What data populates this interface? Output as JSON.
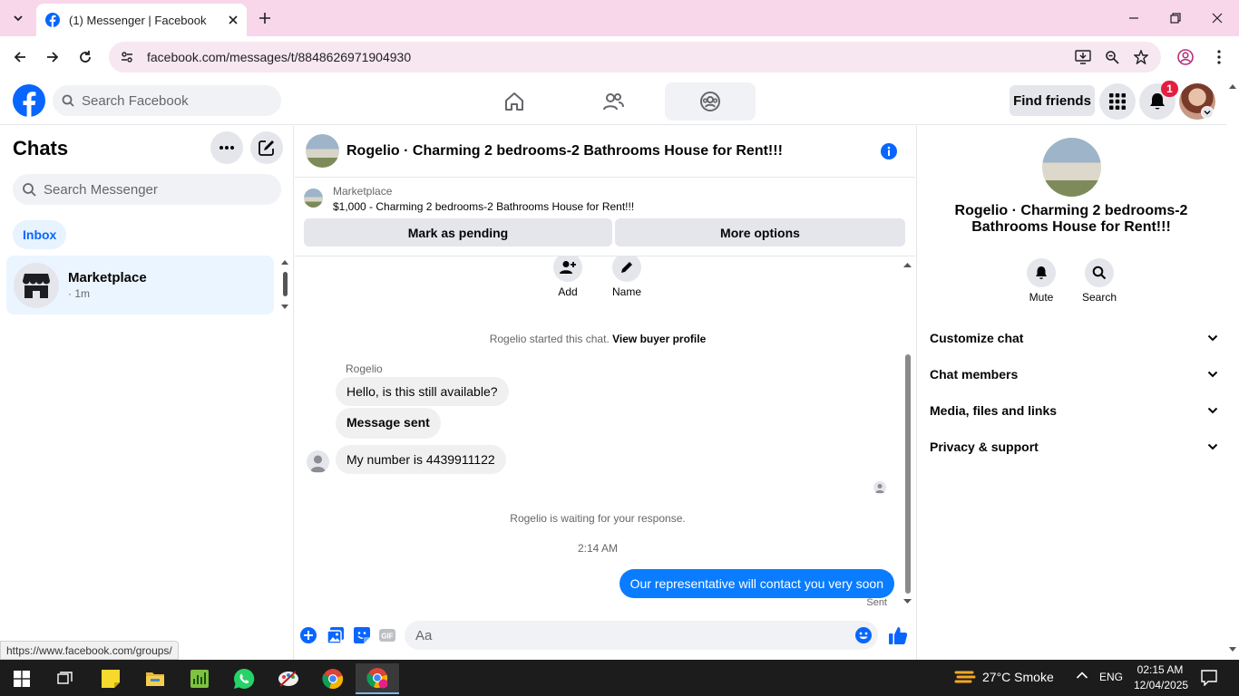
{
  "browser": {
    "tab_title": "(1) Messenger | Facebook",
    "url": "facebook.com/messages/t/8848626971904930",
    "status_url": "https://www.facebook.com/groups/"
  },
  "header": {
    "search_placeholder": "Search Facebook",
    "find_friends": "Find friends",
    "notification_count": "1"
  },
  "sidebar": {
    "title": "Chats",
    "search_placeholder": "Search Messenger",
    "filter_inbox": "Inbox",
    "chats": [
      {
        "name": "Marketplace",
        "time": "· 1m"
      }
    ]
  },
  "conversation": {
    "title": "Rogelio · Charming 2 bedrooms-2 Bathrooms House for Rent!!!",
    "listing_label": "Marketplace",
    "listing_desc": "$1,000 - Charming 2 bedrooms-2 Bathrooms House for Rent!!!",
    "mark_pending": "Mark as pending",
    "more_options": "More options",
    "actions": {
      "add": "Add",
      "name": "Name"
    },
    "started_text": "Rogelio started this chat.",
    "view_profile": "View buyer profile",
    "sender_name": "Rogelio",
    "messages": [
      "Hello, is this still available?",
      "Message sent",
      "My number is 4439911122"
    ],
    "waiting_text": "Rogelio is waiting for your response.",
    "timestamp": "2:14 AM",
    "my_message": "Our representative will contact you very soon",
    "sent_label": "Sent",
    "composer_placeholder": "Aa"
  },
  "details": {
    "title": "Rogelio · Charming 2 bedrooms-2 Bathrooms House for Rent!!!",
    "mute": "Mute",
    "search": "Search",
    "sections": [
      "Customize chat",
      "Chat members",
      "Media, files and links",
      "Privacy & support"
    ]
  },
  "taskbar": {
    "weather": "27°C  Smoke",
    "lang": "ENG",
    "time": "02:15 AM",
    "date": "12/04/2025"
  },
  "colors": {
    "accent": "#0a7cff",
    "fb_blue": "#0866ff",
    "tabbar": "#f9d7ea"
  }
}
